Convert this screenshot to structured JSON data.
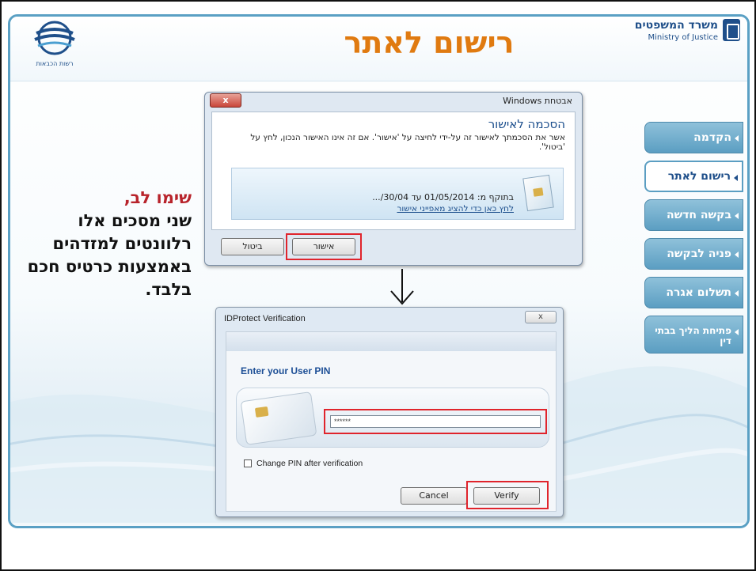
{
  "header": {
    "page_title": "רישום לאתר",
    "ministry_he": "משרד המשפטים",
    "ministry_en": "Ministry of Justice",
    "left_logo_text": "רשות הכבאות"
  },
  "nav": {
    "items": [
      {
        "label": "הקדמה",
        "active": false
      },
      {
        "label": "רישום לאתר",
        "active": true
      },
      {
        "label": "בקשה חדשה",
        "active": false
      },
      {
        "label": "פניה לבקשה",
        "active": false
      },
      {
        "label": "תשלום אגרה",
        "active": false
      },
      {
        "label": "פתיחת הליך בבתי דין",
        "active": false
      }
    ]
  },
  "notice": {
    "heading": "שימו לב,",
    "body": "שני מסכים אלו רלוונטים למזדהים באמצעות כרטיס חכם בלבד."
  },
  "windows_dialog": {
    "title": "אבטחת Windows",
    "close_label": "x",
    "heading": "הסכמה לאישור",
    "description": "אשר את הסכמתך לאישור זה על-ידי לחיצה על 'אישור'. אם זה אינו האישור הנכון, לחץ על 'ביטול'.",
    "validity": "בתוקף מ: 01/05/2014 עד 30/04/...",
    "link": "לחץ כאן כדי להציג מאפייני אישור",
    "ok_label": "אישור",
    "cancel_label": "ביטול"
  },
  "idprotect_dialog": {
    "title": "IDProtect Verification",
    "close_label": "x",
    "prompt": "Enter your User PIN",
    "pin_value": "******",
    "checkbox_label": "Change PIN after verification",
    "checkbox_checked": false,
    "cancel_label": "Cancel",
    "verify_label": "Verify"
  },
  "colors": {
    "accent_orange": "#e07a10",
    "nav_blue": "#5b9ec2",
    "highlight_red": "#e0242c",
    "notice_red": "#b8232b"
  }
}
